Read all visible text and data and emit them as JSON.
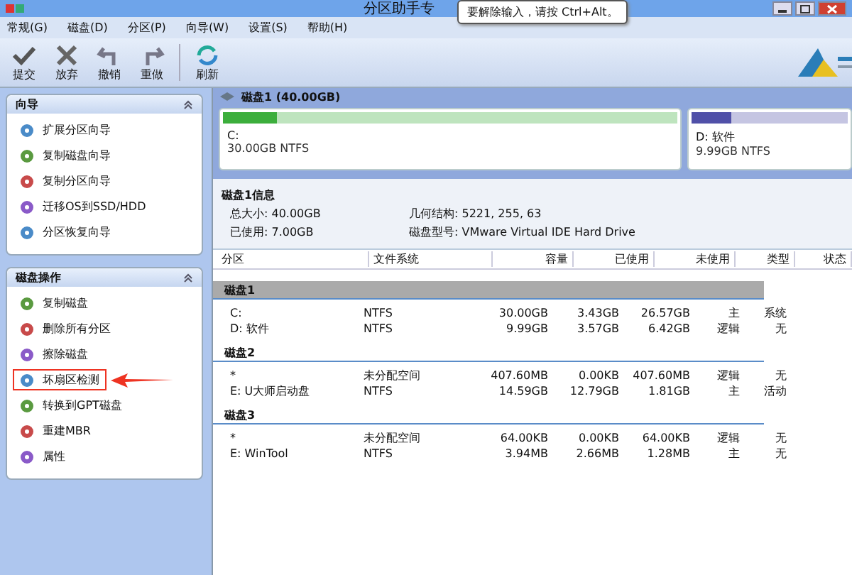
{
  "window": {
    "title": "分区助手专"
  },
  "tooltip": "要解除输入，请按 Ctrl+Alt。",
  "menu": [
    "常规(G)",
    "磁盘(D)",
    "分区(P)",
    "向导(W)",
    "设置(S)",
    "帮助(H)"
  ],
  "toolbar": [
    {
      "label": "提交",
      "kind": "check"
    },
    {
      "label": "放弃",
      "kind": "cross"
    },
    {
      "label": "撤销",
      "kind": "undo"
    },
    {
      "label": "重做",
      "kind": "redo"
    },
    {
      "label": "刷新",
      "kind": "refresh"
    }
  ],
  "sidebar": {
    "panels": [
      {
        "title": "向导",
        "items": [
          {
            "label": "扩展分区向导",
            "highlighted": false
          },
          {
            "label": "复制磁盘向导",
            "highlighted": false
          },
          {
            "label": "复制分区向导",
            "highlighted": false
          },
          {
            "label": "迁移OS到SSD/HDD",
            "highlighted": false
          },
          {
            "label": "分区恢复向导",
            "highlighted": false
          }
        ]
      },
      {
        "title": "磁盘操作",
        "items": [
          {
            "label": "复制磁盘",
            "highlighted": false
          },
          {
            "label": "删除所有分区",
            "highlighted": false
          },
          {
            "label": "擦除磁盘",
            "highlighted": false
          },
          {
            "label": "坏扇区检测",
            "highlighted": true
          },
          {
            "label": "转换到GPT磁盘",
            "highlighted": false
          },
          {
            "label": "重建MBR",
            "highlighted": false
          },
          {
            "label": "属性",
            "highlighted": false
          }
        ]
      }
    ]
  },
  "disk_map": {
    "title": "磁盘1 (40.00GB)",
    "partitions": [
      {
        "name": "C:",
        "detail": "30.00GB NTFS",
        "level": 0.12,
        "color": "#3cae3c"
      },
      {
        "name": "D: 软件",
        "detail": "9.99GB NTFS",
        "level": 0.25,
        "color": "#5050a8"
      }
    ]
  },
  "disk_info": {
    "title": "磁盘1信息",
    "fields": [
      {
        "label": "总大小:",
        "value": "40.00GB"
      },
      {
        "label": "几何结构:",
        "value": "5221, 255, 63"
      },
      {
        "label": "已使用:",
        "value": "7.00GB"
      },
      {
        "label": "磁盘型号:",
        "value": "VMware Virtual IDE Hard Drive"
      }
    ]
  },
  "table": {
    "columns": [
      "分区",
      "文件系统",
      "容量",
      "已使用",
      "未使用",
      "类型",
      "状态"
    ],
    "groups": [
      {
        "name": "磁盘1",
        "selected": true,
        "rows": [
          [
            "C:",
            "NTFS",
            "30.00GB",
            "3.43GB",
            "26.57GB",
            "主",
            "系统"
          ],
          [
            "D: 软件",
            "NTFS",
            "9.99GB",
            "3.57GB",
            "6.42GB",
            "逻辑",
            "无"
          ]
        ]
      },
      {
        "name": "磁盘2",
        "selected": false,
        "rows": [
          [
            "*",
            "未分配空间",
            "407.60MB",
            "0.00KB",
            "407.60MB",
            "逻辑",
            "无"
          ],
          [
            "E: U大师启动盘",
            "NTFS",
            "14.59GB",
            "12.79GB",
            "1.81GB",
            "主",
            "活动"
          ]
        ]
      },
      {
        "name": "磁盘3",
        "selected": false,
        "rows": [
          [
            "*",
            "未分配空间",
            "64.00KB",
            "0.00KB",
            "64.00KB",
            "逻辑",
            "无"
          ],
          [
            "E: WinTool",
            "NTFS",
            "3.94MB",
            "2.66MB",
            "1.28MB",
            "主",
            "无"
          ]
        ]
      }
    ]
  }
}
